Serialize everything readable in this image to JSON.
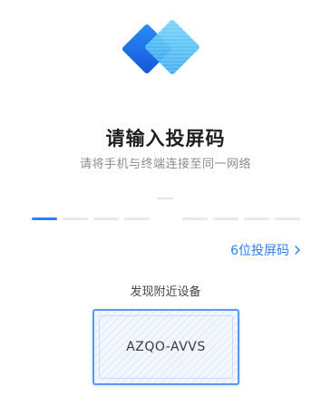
{
  "header": {
    "title": "请输入投屏码",
    "subtitle": "请将手机与终端连接至同一网络"
  },
  "code_input": {
    "slots": [
      "",
      "",
      "",
      "",
      "",
      "",
      "",
      ""
    ],
    "active_slot_index": 0
  },
  "code_type_link": {
    "label": "6位投屏码",
    "icon": "chevron-right-icon"
  },
  "discovery": {
    "label": "发现附近设备",
    "devices": [
      {
        "name": "AZQO-AVVS"
      }
    ]
  },
  "colors": {
    "accent": "#2f7ef6",
    "logo_dark": "#1e6ef0",
    "logo_light": "#4fc6f5"
  }
}
